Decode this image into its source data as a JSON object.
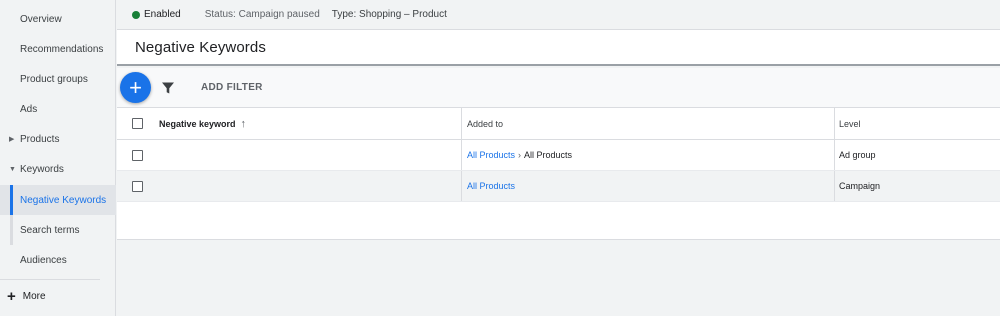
{
  "sidebar": {
    "items": [
      {
        "label": "Overview"
      },
      {
        "label": "Recommendations"
      },
      {
        "label": "Product groups"
      },
      {
        "label": "Ads"
      },
      {
        "label": "Products"
      },
      {
        "label": "Keywords"
      },
      {
        "label": "Negative Keywords"
      },
      {
        "label": "Search terms"
      },
      {
        "label": "Audiences"
      }
    ],
    "more_label": "More"
  },
  "status": {
    "enabled": "Enabled",
    "status_text": "Status: Campaign paused",
    "type_text": "Type: Shopping – Product"
  },
  "page": {
    "title": "Negative Keywords"
  },
  "toolbar": {
    "add_filter": "ADD FILTER"
  },
  "table": {
    "headers": {
      "keyword": "Negative keyword",
      "added_to": "Added to",
      "level": "Level"
    },
    "rows": [
      {
        "keyword": "",
        "added_link": "All Products",
        "added_separator": "›",
        "added_tail": "All Products",
        "level": "Ad group"
      },
      {
        "keyword": "",
        "added_link": "All Products",
        "added_separator": "",
        "added_tail": "",
        "level": "Campaign"
      }
    ]
  },
  "colors": {
    "accent": "#1a73e8",
    "enabled_dot": "#188038"
  }
}
